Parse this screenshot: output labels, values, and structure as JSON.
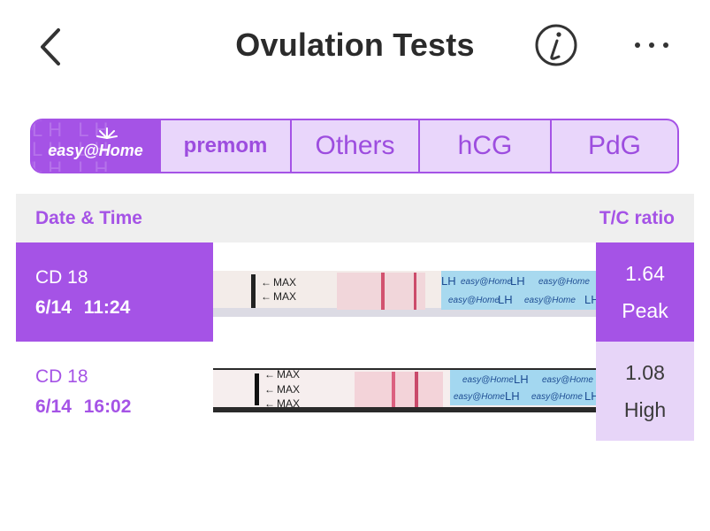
{
  "header": {
    "title": "Ovulation Tests",
    "back_icon": "chevron-left-icon",
    "info_icon": "info-icon",
    "more_icon": "more-horizontal-icon"
  },
  "brand_tabs": [
    {
      "label": "easy@Home",
      "selected": true
    },
    {
      "label": "premom",
      "selected": false
    },
    {
      "label": "Others",
      "selected": false
    },
    {
      "label": "hCG",
      "selected": false
    },
    {
      "label": "PdG",
      "selected": false
    }
  ],
  "table": {
    "col_date": "Date & Time",
    "col_ratio": "T/C ratio",
    "rows": [
      {
        "cycle_day": "CD 18",
        "datetime": "6/14 11:24",
        "ratio": "1.64",
        "level": "Peak",
        "selected": true
      },
      {
        "cycle_day": "CD 18",
        "datetime": "6/14 16:02",
        "ratio": "1.08",
        "level": "High",
        "selected": false
      }
    ]
  },
  "strip_text": {
    "max": "MAX",
    "lh": "LH",
    "brand": "easy@Home"
  },
  "colors": {
    "accent": "#a553e6",
    "accent_light": "#e7d5f8",
    "header_bg": "#efefef"
  }
}
